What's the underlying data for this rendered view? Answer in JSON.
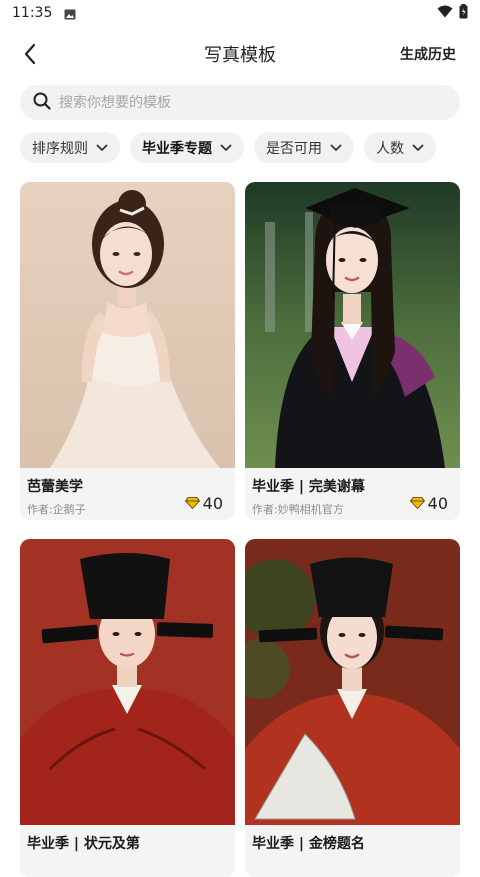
{
  "status_bar": {
    "time": "11:35"
  },
  "header": {
    "title": "写真模板",
    "history_link": "生成历史"
  },
  "search": {
    "placeholder": "搜索你想要的模板",
    "value": ""
  },
  "filters": [
    {
      "label": "排序规则",
      "active": false
    },
    {
      "label": "毕业季专题",
      "active": true
    },
    {
      "label": "是否可用",
      "active": false
    },
    {
      "label": "人数",
      "active": false
    }
  ],
  "templates": [
    {
      "title": "芭蕾美学",
      "author": "作者:企鹅子",
      "price": "40"
    },
    {
      "title": "毕业季 | 完美谢幕",
      "author": "作者:妙鸭相机官方",
      "price": "40"
    },
    {
      "title": "毕业季 | 状元及第",
      "author": "",
      "price": ""
    },
    {
      "title": "毕业季 | 金榜题名",
      "author": "",
      "price": ""
    }
  ],
  "colors": {
    "search_bg": "#f2f2f3",
    "chip_bg": "#f1f1f2",
    "gem": "#f5b800",
    "card_bg": "#f4f4f5"
  }
}
